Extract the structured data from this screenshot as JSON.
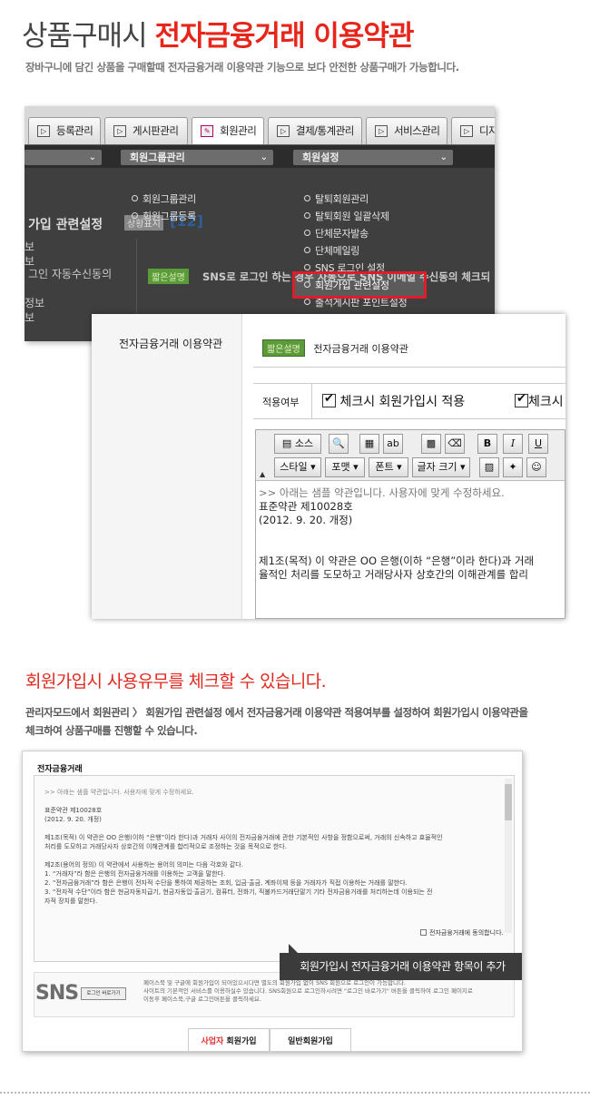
{
  "heading": {
    "main": "상품구매시 ",
    "highlight": "전자금융거래 이용약관"
  },
  "subtitle": "장바구니에 담긴 상품을 구매할때 전자금융거래 이용약관 기능으로 보다 안전한 상품구매가 가능합니다.",
  "admin": {
    "tabs": [
      {
        "label": "등록관리"
      },
      {
        "label": "게시판관리"
      },
      {
        "label": "회원관리"
      },
      {
        "label": "결제/통계관리"
      },
      {
        "label": "서비스관리"
      },
      {
        "label": "디자"
      }
    ],
    "dropdowns": [
      "회원그룹관리",
      "회원설정"
    ],
    "group_menu": [
      "회원그룹관리",
      "회원그룹등록"
    ],
    "settings_menu": [
      "탈퇴회원관리",
      "탈퇴회원 일괄삭제",
      "단체문자발송",
      "단체메일링",
      "SNS 로그인 설정",
      "회원가입 관련설정",
      "출석게시판 포인트설정"
    ],
    "bg_title": "가입 관련설정",
    "bg_badge": "상황표시",
    "bg_count": "[12]",
    "bg_left": [
      "보",
      "보",
      "그인 자동수신동의",
      "정보",
      "보"
    ],
    "bg_note_badge": "짧은설명",
    "bg_note": "SNS로 로그인 하는 경우 자동으로 SNS 이메일 수신동의 체크되"
  },
  "settings": {
    "label": "전자금융거래 이용약관",
    "badge": "짧은설명",
    "title": "전자금융거래 이용약관",
    "apply_label": "적용여부",
    "check1": "체크시 회원가입시 적용",
    "check2": "체크시",
    "toolbar": {
      "source": "소스",
      "bold": "B",
      "italic": "I",
      "underline": "U",
      "style": "스타일",
      "format": "포맷",
      "font": "폰트",
      "size": "글자 크기"
    },
    "content": [
      ">> 아래는 샘플 약관입니다. 사용자에 맞게 수정하세요.",
      "",
      "표준약관 제10028호",
      "(2012. 9. 20. 개정)",
      "",
      "",
      "제1조(목적) 이 약관은 OO 은행(이하 “은행”이라 한다)과 거래",
      "율적인 처리를 도모하고 거래당사자 상호간의 이해관계를 합리"
    ]
  },
  "section2": {
    "title": "회원가입시 사용유무를 체크할 수 있습니다.",
    "desc_line1": "관리자모드에서 회원관리 〉 회원가입 관련설정 에서 전자금융거래 이용약관 적용여부를 설정하여 회원가입시 이용약관을",
    "desc_line2": "체크하여 상품구매를 진행할 수 있습니다."
  },
  "preview": {
    "title": "전자금융거래",
    "lines": [
      ">> 아래는 샘플 약관입니다. 사용자에 맞게 수정하세요.",
      "",
      "표준약관 제10028호",
      "(2012. 9. 20. 개정)",
      "",
      "제1조(목적) 이 약관은 OO 은행(이하 “은행”이라 한다)과 거래자 사이의 전자금융거래에 관한 기본적인 사항을 정함으로써, 거래의 신속하고 효율적인",
      "처리를 도모하고 거래당사자 상호간의 이해관계를 합리적으로 조정하는 것을 목적으로 한다.",
      "",
      "제2조(용어의 정의) 이 약관에서 사용하는 용어의 의미는 다음 각호와 같다.",
      "    1. “거래자”라 함은 은행의 전자금융거래를 이용하는 고객을 말한다.",
      "    2. “전자금융거래”라 함은 은행이 전자적 수단을 통하여 제공하는 조회, 입금·출금, 계좌이체 등을 거래자가 직접 이용하는 거래를 말한다.",
      "    3. “전자적 수단”이라 함은 현금자동지급기, 현금자동입·출금기, 컴퓨터, 전화기, 직불카드거래단말기 기타 전자금융거래를 처리하는데 이용되는 전",
      "자적 장치를 말한다."
    ],
    "agree": "전자금융거래에 동의합니다.",
    "tooltip": "회원가입시 전자금융거래 이용약관 항목이 추가",
    "sns_logo": "SNS",
    "sns_btn": "로그인 바로가기",
    "sns_text": [
      "페이스북 및 구글에 회원가입이 되어있으시다면 별도의 회원가입 없이 SNS 회원으로 로그인이 가능합니다.",
      "사이트의 기본적인 서비스를 이용하실수 있습니다. SNS회원으로 로그인하시려면 \"로그인 바로가기\" 버튼을 클릭하여 로그인 페이지로",
      "이동후 페이스북,구글 로그인버튼을 클릭하세요."
    ],
    "btn_business_prefix": "사업자",
    "btn_business_suffix": " 회원가입",
    "btn_general": "일반회원가입"
  }
}
